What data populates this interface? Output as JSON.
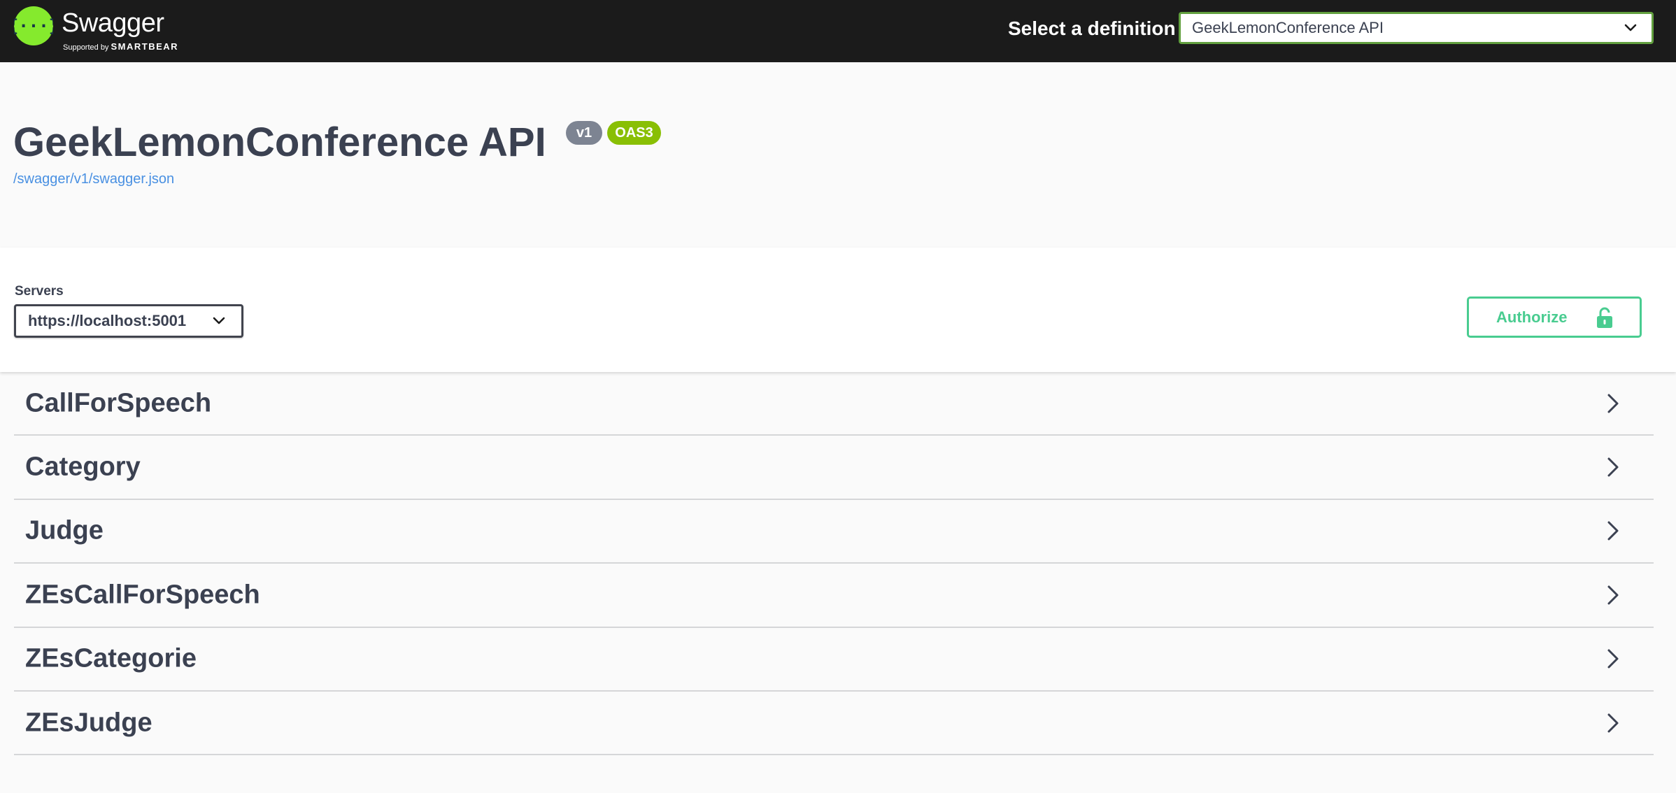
{
  "topbar": {
    "logo_word": "Swagger",
    "logo_supported_by": "Supported by",
    "logo_company": "SMARTBEAR",
    "definition_label": "Select a definition",
    "definition_value": "GeekLemonConference API"
  },
  "info": {
    "title": "GeekLemonConference API",
    "version_badge": "v1",
    "oas_badge": "OAS3",
    "spec_url": "/swagger/v1/swagger.json"
  },
  "servers": {
    "label": "Servers",
    "selected": "https://localhost:5001"
  },
  "authorize": {
    "label": "Authorize"
  },
  "tags": [
    {
      "name": "CallForSpeech"
    },
    {
      "name": "Category"
    },
    {
      "name": "Judge"
    },
    {
      "name": "ZEsCallForSpeech"
    },
    {
      "name": "ZEsCategorie"
    },
    {
      "name": "ZEsJudge"
    }
  ],
  "colors": {
    "topbar_bg": "#1b1b1b",
    "logo_green": "#85ea2d",
    "select_border": "#62a03f",
    "badge_version": "#7d8492",
    "badge_oas": "#89bf04",
    "link": "#4990e2",
    "authorize": "#49cc90",
    "text": "#3b4151"
  },
  "icons": {
    "logo": "swagger-logo-icon",
    "dropdown": "chevron-down-icon",
    "lock": "unlocked-padlock-icon",
    "expand": "chevron-right-icon"
  }
}
